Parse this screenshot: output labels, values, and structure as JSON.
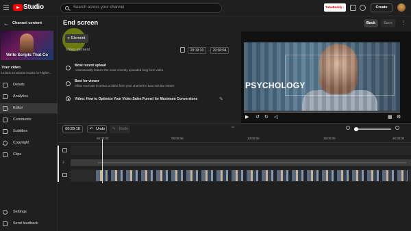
{
  "app": {
    "title": "Studio",
    "search_placeholder": "Search across your channel",
    "chip_label": "TubeBuddy ↓",
    "create_label": "Create"
  },
  "sidebar": {
    "header": "Channel content",
    "thumbnail_caption": "Write Scripts That Co",
    "your_video_label": "Your video",
    "video_subtitle": "Unlock Emotional Hooks for Higher...",
    "items": [
      {
        "label": "Details",
        "icon": "pencil-icon"
      },
      {
        "label": "Analytics",
        "icon": "bar-chart-icon"
      },
      {
        "label": "Editor",
        "icon": "film-icon",
        "active": true
      },
      {
        "label": "Comments",
        "icon": "comment-icon"
      },
      {
        "label": "Subtitles",
        "icon": "subtitles-icon"
      },
      {
        "label": "Copyright",
        "icon": "copyright-icon"
      },
      {
        "label": "Clips",
        "icon": "scissors-icon"
      }
    ],
    "settings_label": "Settings",
    "feedback_label": "Send feedback"
  },
  "header": {
    "title": "End screen",
    "back_label": "Back",
    "save_label": "Save"
  },
  "element": {
    "button_label": "Element",
    "video_element_label": "Video element",
    "start_time": "20:19:10",
    "end_time": "20:30:04",
    "options": [
      {
        "title": "Most recent upload",
        "desc": "Automatically feature the most recently uploaded long form video",
        "selected": false
      },
      {
        "title": "Best for viewer",
        "desc": "Allow YouTube to select a video from your channel to best suit the viewer",
        "selected": false
      },
      {
        "title": "Video: How to Optimize Your Video Sales Funnel for Maximum Conversions",
        "desc": "",
        "selected": true
      }
    ]
  },
  "preview": {
    "overlay_text": "PSYCHOLOGY"
  },
  "timeline": {
    "timecode": "00:29:18",
    "undo_label": "Undo",
    "redo_label": "Redo",
    "ticks": [
      "00:00:00",
      "05:00:00",
      "10:00:00",
      "15:00:00",
      "20:30:04"
    ]
  },
  "colors": {
    "accent_red": "#ff0000",
    "highlight_spot": "#c8e600",
    "background": "#1f1f1f"
  }
}
